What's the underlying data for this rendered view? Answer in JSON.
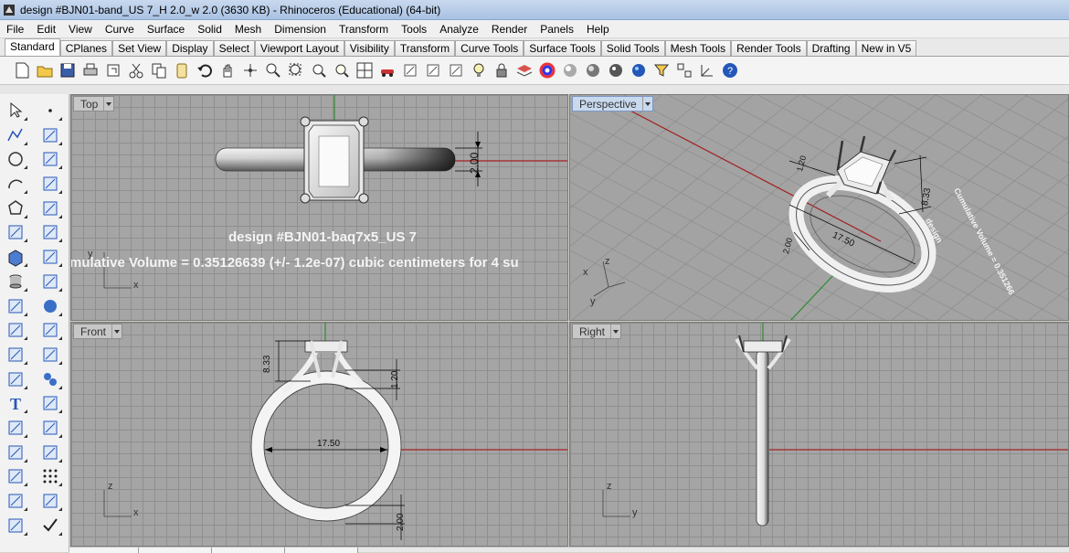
{
  "window": {
    "title": "design #BJN01-band_US 7_H 2.0_w 2.0 (3630 KB) - Rhinoceros (Educational) (64-bit)"
  },
  "menu": [
    "File",
    "Edit",
    "View",
    "Curve",
    "Surface",
    "Solid",
    "Mesh",
    "Dimension",
    "Transform",
    "Tools",
    "Analyze",
    "Render",
    "Panels",
    "Help"
  ],
  "tabs": [
    {
      "label": "Standard",
      "active": true
    },
    {
      "label": "CPlanes"
    },
    {
      "label": "Set View"
    },
    {
      "label": "Display"
    },
    {
      "label": "Select"
    },
    {
      "label": "Viewport Layout"
    },
    {
      "label": "Visibility"
    },
    {
      "label": "Transform"
    },
    {
      "label": "Curve Tools"
    },
    {
      "label": "Surface Tools"
    },
    {
      "label": "Solid Tools"
    },
    {
      "label": "Mesh Tools"
    },
    {
      "label": "Render Tools"
    },
    {
      "label": "Drafting"
    },
    {
      "label": "New in V5"
    }
  ],
  "toolbar_icons": [
    "new-file-icon",
    "open-file-icon",
    "save-icon",
    "print-icon",
    "import-icon",
    "cut-icon",
    "copy-icon",
    "paste-icon",
    "undo-icon",
    "pan-hand-icon",
    "rotate-view-icon",
    "zoom-icon",
    "zoom-window-icon",
    "zoom-extents-icon",
    "zoom-selected-icon",
    "four-viewports-icon",
    "car-icon",
    "named-view-icon",
    "named-cplane-icon",
    "cplane-origin-icon",
    "light-bulb-icon",
    "lock-icon",
    "layer-icon",
    "color-wheel-icon",
    "shaded-sphere-icon",
    "rendered-sphere-icon",
    "render-sphere-icon",
    "blue-sphere-icon",
    "select-filter-icon",
    "osnap-icon",
    "gumball-icon",
    "help-icon"
  ],
  "left_tools_col1": [
    "select-arrow-icon",
    "polyline-icon",
    "circle-icon",
    "arc-icon",
    "polygon-icon",
    "rebuild-surface-icon",
    "box-icon",
    "cylinder-icon",
    "boolean-icon",
    "transform-icon",
    "split-icon",
    "fillet-icon",
    "text-icon",
    "array-icon",
    "solid-box-icon",
    "grid-snap-icon",
    "analyze-icon",
    "dimension-icon"
  ],
  "left_tools_col2": [
    "point-icon",
    "curve-points-icon",
    "ellipse-icon",
    "rectangle-icon",
    "curve-icon",
    "extrude-icon",
    "patch-icon",
    "plane-icon",
    "sphere-icon",
    "mirror-icon",
    "scale-icon",
    "spheres-icon",
    "join-icon",
    "align-icon",
    "pencil-icon",
    "dots-icon",
    "block-icon",
    "check-icon"
  ],
  "viewports": {
    "top": {
      "label": "Top",
      "overlay_title": "design #BJN01-baq7x5_US 7",
      "overlay_volume": "mulative Volume = 0.35126639 (+/- 1.2e-07) cubic centimeters for 4 su",
      "dimension": "2.00",
      "axis_x": "x",
      "axis_y": "y"
    },
    "perspective": {
      "label": "Perspective",
      "dimensions": [
        "8.33",
        "17.50",
        "1.20",
        "2.00"
      ],
      "rotated_note": "Cumulative Volume = 0.351266",
      "rotated_note2": "design",
      "axis_x": "x",
      "axis_y": "y",
      "axis_z": "z"
    },
    "front": {
      "label": "Front",
      "dim_height": "8.33",
      "dim_prong": "1.20",
      "dim_diameter": "17.50",
      "dim_band": "2.00",
      "axis_x": "x",
      "axis_z": "z"
    },
    "right": {
      "label": "Right",
      "axis_y": "y",
      "axis_z": "z"
    }
  },
  "colors": {
    "viewport_bg": "#a5a5a5",
    "grid": "#8f8f8f",
    "x_axis": "#a32020",
    "y_axis": "#2e8b2e",
    "active_label": "#c9d9ee"
  }
}
